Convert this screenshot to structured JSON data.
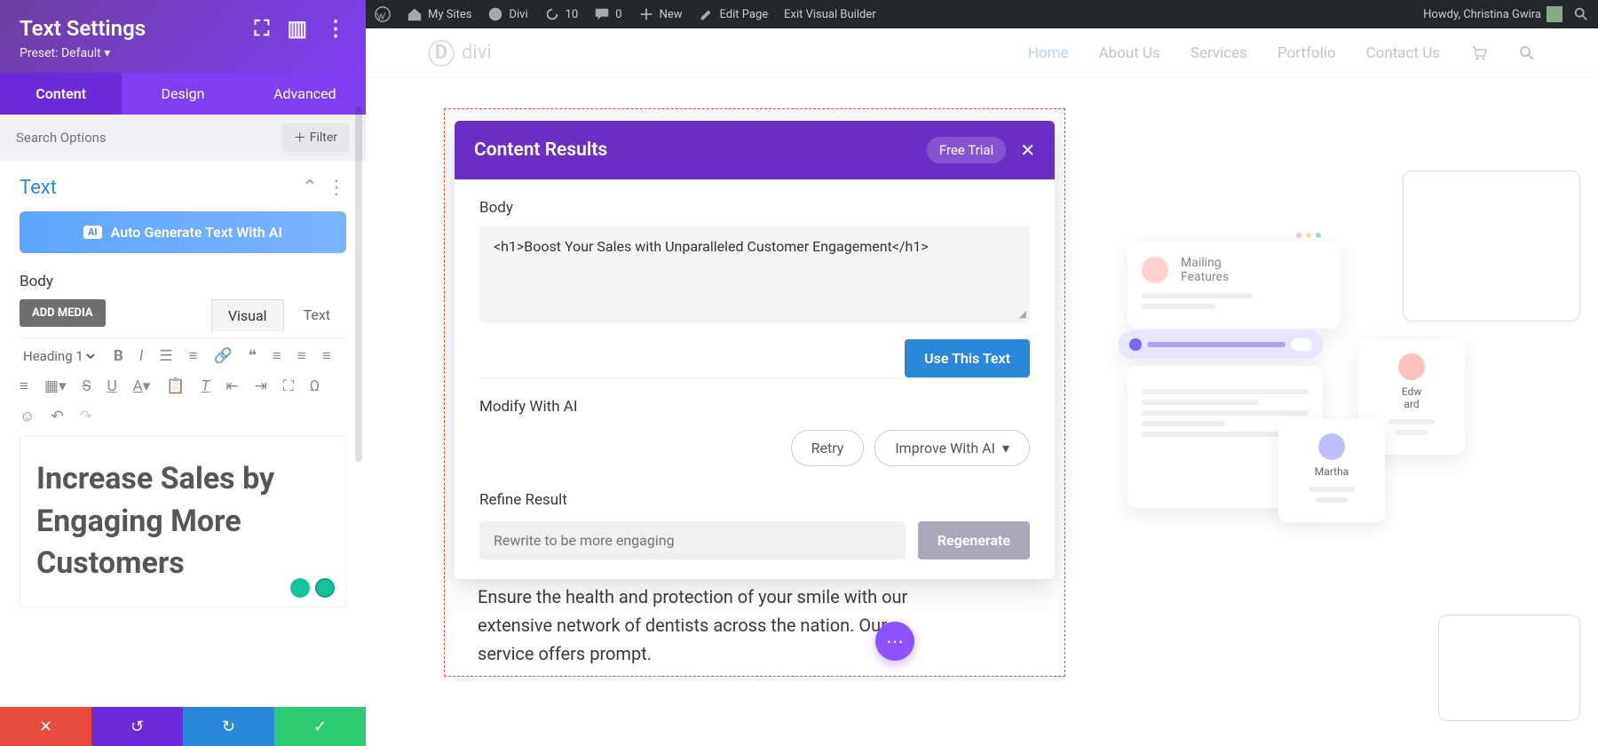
{
  "admin_bar": {
    "my_sites": "My Sites",
    "divi": "Divi",
    "updates": "10",
    "comments": "0",
    "new": "New",
    "edit_page": "Edit Page",
    "exit_vb": "Exit Visual Builder",
    "howdy": "Howdy, Christina Gwira"
  },
  "sidebar": {
    "title": "Text Settings",
    "preset": "Preset: Default ▾",
    "tabs": {
      "content": "Content",
      "design": "Design",
      "advanced": "Advanced"
    },
    "search_placeholder": "Search Options",
    "filter_btn": "Filter",
    "section": "Text",
    "auto_generate": "Auto Generate Text With AI",
    "body_label": "Body",
    "add_media": "ADD MEDIA",
    "editor_tabs": {
      "visual": "Visual",
      "text": "Text"
    },
    "heading_dropdown": "Heading 1",
    "editor_html": "Increase Sales by Engaging More Customers"
  },
  "site_nav": {
    "logo": "divi",
    "items": [
      "Home",
      "About Us",
      "Services",
      "Portfolio",
      "Contact Us"
    ]
  },
  "modal": {
    "title": "Content Results",
    "free_trial": "Free Trial",
    "body_label": "Body",
    "result_text": "<h1>Boost Your Sales with Unparalleled Customer Engagement</h1>",
    "use_text": "Use This Text",
    "modify_label": "Modify With AI",
    "retry": "Retry",
    "improve": "Improve With AI",
    "refine_label": "Refine Result",
    "refine_placeholder": "Rewrite to be more engaging",
    "regenerate": "Regenerate"
  },
  "page_text": "Ensure the health and protection of your smile with our extensive network of dentists across the nation. Our service offers prompt.",
  "illus": {
    "mailing": "Mailing",
    "features": "Features",
    "edward": "Edw\nard",
    "martha": "Martha"
  }
}
